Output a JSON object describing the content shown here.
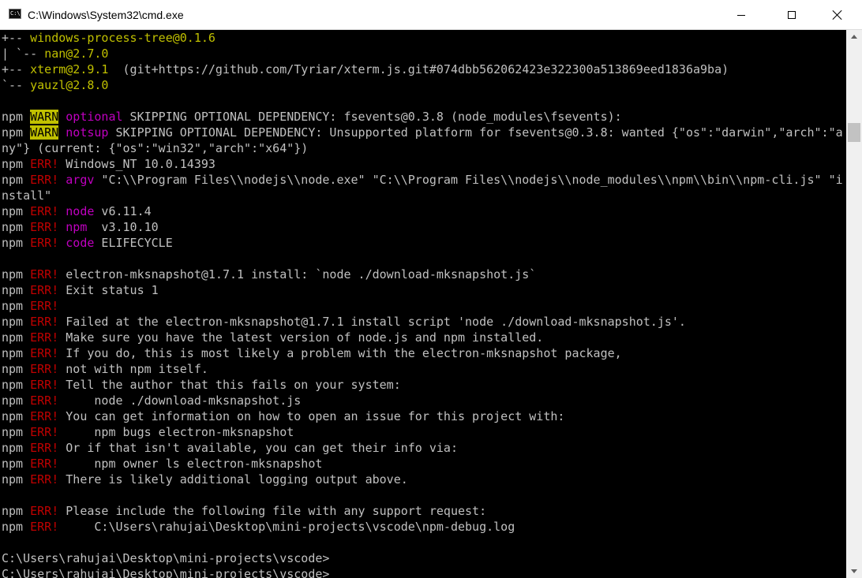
{
  "window": {
    "title": "C:\\Windows\\System32\\cmd.exe",
    "icon_text": "C:\\",
    "icon": "cmd-icon",
    "minimize_icon": "minimize-icon",
    "maximize_icon": "maximize-icon",
    "close_icon": "close-icon"
  },
  "colors": {
    "background": "#000000",
    "default_text": "#c0c0c0",
    "yellow": "#c0c000",
    "magenta": "#c000c0",
    "red": "#c00000",
    "warn_background": "#c0c000"
  },
  "lines": [
    [
      {
        "t": "+-- ",
        "c": ""
      },
      {
        "t": "windows-process-tree@0.1.6",
        "c": "y"
      }
    ],
    [
      {
        "t": "| `-- ",
        "c": ""
      },
      {
        "t": "nan@2.7.0",
        "c": "y"
      }
    ],
    [
      {
        "t": "+-- ",
        "c": ""
      },
      {
        "t": "xterm@2.9.1",
        "c": "y"
      },
      {
        "t": "  (git+https://github.com/Tyriar/xterm.js.git#074dbb562062423e322300a513869eed1836a9ba)",
        "c": ""
      }
    ],
    [
      {
        "t": "`-- ",
        "c": ""
      },
      {
        "t": "yauzl@2.8.0",
        "c": "y"
      }
    ],
    [],
    [
      {
        "t": "npm ",
        "c": ""
      },
      {
        "t": "WARN",
        "c": "wbg"
      },
      {
        "t": " ",
        "c": ""
      },
      {
        "t": "optional",
        "c": "m"
      },
      {
        "t": " SKIPPING OPTIONAL DEPENDENCY: fsevents@0.3.8 (node_modules\\fsevents):",
        "c": ""
      }
    ],
    [
      {
        "t": "npm ",
        "c": ""
      },
      {
        "t": "WARN",
        "c": "wbg"
      },
      {
        "t": " ",
        "c": ""
      },
      {
        "t": "notsup",
        "c": "m"
      },
      {
        "t": " SKIPPING OPTIONAL DEPENDENCY: Unsupported platform for fsevents@0.3.8: wanted {\"os\":\"darwin\",\"arch\":\"a",
        "c": ""
      }
    ],
    [
      {
        "t": "ny\"} (current: {\"os\":\"win32\",\"arch\":\"x64\"})",
        "c": ""
      }
    ],
    [
      {
        "t": "npm ",
        "c": ""
      },
      {
        "t": "ERR!",
        "c": "r"
      },
      {
        "t": " Windows_NT 10.0.14393",
        "c": ""
      }
    ],
    [
      {
        "t": "npm ",
        "c": ""
      },
      {
        "t": "ERR!",
        "c": "r"
      },
      {
        "t": " ",
        "c": ""
      },
      {
        "t": "argv",
        "c": "m"
      },
      {
        "t": " \"C:\\\\Program Files\\\\nodejs\\\\node.exe\" \"C:\\\\Program Files\\\\nodejs\\\\node_modules\\\\npm\\\\bin\\\\npm-cli.js\" \"i",
        "c": ""
      }
    ],
    [
      {
        "t": "nstall\"",
        "c": ""
      }
    ],
    [
      {
        "t": "npm ",
        "c": ""
      },
      {
        "t": "ERR!",
        "c": "r"
      },
      {
        "t": " ",
        "c": ""
      },
      {
        "t": "node",
        "c": "m"
      },
      {
        "t": " v6.11.4",
        "c": ""
      }
    ],
    [
      {
        "t": "npm ",
        "c": ""
      },
      {
        "t": "ERR!",
        "c": "r"
      },
      {
        "t": " ",
        "c": ""
      },
      {
        "t": "npm",
        "c": "m"
      },
      {
        "t": "  v3.10.10",
        "c": ""
      }
    ],
    [
      {
        "t": "npm ",
        "c": ""
      },
      {
        "t": "ERR!",
        "c": "r"
      },
      {
        "t": " ",
        "c": ""
      },
      {
        "t": "code",
        "c": "m"
      },
      {
        "t": " ELIFECYCLE",
        "c": ""
      }
    ],
    [],
    [
      {
        "t": "npm ",
        "c": ""
      },
      {
        "t": "ERR!",
        "c": "r"
      },
      {
        "t": " electron-mksnapshot@1.7.1 install: `node ./download-mksnapshot.js`",
        "c": ""
      }
    ],
    [
      {
        "t": "npm ",
        "c": ""
      },
      {
        "t": "ERR!",
        "c": "r"
      },
      {
        "t": " Exit status 1",
        "c": ""
      }
    ],
    [
      {
        "t": "npm ",
        "c": ""
      },
      {
        "t": "ERR!",
        "c": "r"
      }
    ],
    [
      {
        "t": "npm ",
        "c": ""
      },
      {
        "t": "ERR!",
        "c": "r"
      },
      {
        "t": " Failed at the electron-mksnapshot@1.7.1 install script 'node ./download-mksnapshot.js'.",
        "c": ""
      }
    ],
    [
      {
        "t": "npm ",
        "c": ""
      },
      {
        "t": "ERR!",
        "c": "r"
      },
      {
        "t": " Make sure you have the latest version of node.js and npm installed.",
        "c": ""
      }
    ],
    [
      {
        "t": "npm ",
        "c": ""
      },
      {
        "t": "ERR!",
        "c": "r"
      },
      {
        "t": " If you do, this is most likely a problem with the electron-mksnapshot package,",
        "c": ""
      }
    ],
    [
      {
        "t": "npm ",
        "c": ""
      },
      {
        "t": "ERR!",
        "c": "r"
      },
      {
        "t": " not with npm itself.",
        "c": ""
      }
    ],
    [
      {
        "t": "npm ",
        "c": ""
      },
      {
        "t": "ERR!",
        "c": "r"
      },
      {
        "t": " Tell the author that this fails on your system:",
        "c": ""
      }
    ],
    [
      {
        "t": "npm ",
        "c": ""
      },
      {
        "t": "ERR!",
        "c": "r"
      },
      {
        "t": "     node ./download-mksnapshot.js",
        "c": ""
      }
    ],
    [
      {
        "t": "npm ",
        "c": ""
      },
      {
        "t": "ERR!",
        "c": "r"
      },
      {
        "t": " You can get information on how to open an issue for this project with:",
        "c": ""
      }
    ],
    [
      {
        "t": "npm ",
        "c": ""
      },
      {
        "t": "ERR!",
        "c": "r"
      },
      {
        "t": "     npm bugs electron-mksnapshot",
        "c": ""
      }
    ],
    [
      {
        "t": "npm ",
        "c": ""
      },
      {
        "t": "ERR!",
        "c": "r"
      },
      {
        "t": " Or if that isn't available, you can get their info via:",
        "c": ""
      }
    ],
    [
      {
        "t": "npm ",
        "c": ""
      },
      {
        "t": "ERR!",
        "c": "r"
      },
      {
        "t": "     npm owner ls electron-mksnapshot",
        "c": ""
      }
    ],
    [
      {
        "t": "npm ",
        "c": ""
      },
      {
        "t": "ERR!",
        "c": "r"
      },
      {
        "t": " There is likely additional logging output above.",
        "c": ""
      }
    ],
    [],
    [
      {
        "t": "npm ",
        "c": ""
      },
      {
        "t": "ERR!",
        "c": "r"
      },
      {
        "t": " Please include the following file with any support request:",
        "c": ""
      }
    ],
    [
      {
        "t": "npm ",
        "c": ""
      },
      {
        "t": "ERR!",
        "c": "r"
      },
      {
        "t": "     C:\\Users\\rahujai\\Desktop\\mini-projects\\vscode\\npm-debug.log",
        "c": ""
      }
    ],
    [],
    [
      {
        "t": "C:\\Users\\rahujai\\Desktop\\mini-projects\\vscode>",
        "c": ""
      }
    ],
    [
      {
        "t": "C:\\Users\\rahujai\\Desktop\\mini-projects\\vscode>",
        "c": ""
      }
    ]
  ]
}
